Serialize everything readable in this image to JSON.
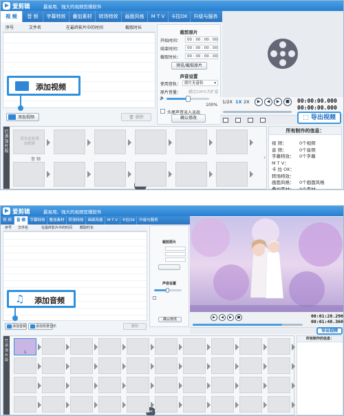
{
  "app": {
    "name": "爱剪辑",
    "slogan": "最易用、强大的视频剪辑软件"
  },
  "tabs": [
    {
      "label": "视 频",
      "active": true
    },
    {
      "label": "音 频"
    },
    {
      "label": "字幕特效"
    },
    {
      "label": "叠加素材"
    },
    {
      "label": "转场特效"
    },
    {
      "label": "画面风格"
    },
    {
      "label": "M T V"
    },
    {
      "label": "卡拉OK"
    },
    {
      "label": "升级与服务"
    }
  ],
  "columns": {
    "index": "序号",
    "name": "文件名",
    "source_time": "在最终影片中的时间",
    "cut_duration": "截取时长"
  },
  "clip_panel": {
    "title": "裁剪原片",
    "start_label": "开始时间：",
    "start_value": "00 : 00 : 00 . 000",
    "end_label": "结束时间：",
    "end_value": "00 : 00 : 00 . 000",
    "duration_label": "截取时长：",
    "duration_value": "00 : 00 : 00 . 000",
    "preview_btn": "预览/截取原片"
  },
  "audio_panel": {
    "title": "声音设置",
    "track_label": "使用音轨：",
    "track_value": "原片无音轨",
    "volume_label": "原片音量：",
    "volume_hint": "超过100%为扩音",
    "volume_value": "100%",
    "volume_level": 0.5,
    "fade_label": "头尾声音淡入淡出",
    "confirm_btn": "确认修改"
  },
  "player": {
    "speeds": [
      "1/2X",
      "1X",
      "2X"
    ],
    "active_speed": "1X",
    "time_current": "00:00:00.000",
    "time_total": "00:00:00.000",
    "export_btn": "导出视频"
  },
  "actions": {
    "add_video_btn": "添加视频",
    "delete_btn": "删除",
    "callout_video": "添加视频"
  },
  "info": {
    "title": "所有制作的信息：",
    "rows": [
      {
        "k": "视    频：",
        "v": "0个视频"
      },
      {
        "k": "音    频：",
        "v": "0个音频"
      },
      {
        "k": "字幕特效：",
        "v": "0个字幕"
      },
      {
        "k": "M  T  V：",
        "v": ""
      },
      {
        "k": "卡  拉  OK：",
        "v": ""
      },
      {
        "k": "转场特效：",
        "v": ""
      },
      {
        "k": "画面风格：",
        "v": "0个画面风格"
      },
      {
        "k": "叠加素材：",
        "v": "0个素材"
      }
    ]
  },
  "timeline": {
    "side_label": "已添加片段",
    "placeholder": "双击此处添加视频",
    "audio_label": "音 频"
  },
  "second": {
    "add_audio_callout": "添加音频",
    "add_audio_btn": "添加音频",
    "add_bgm_btn": "添加背景音乐",
    "time_current": "00:01:28.290",
    "time_total": "00:01:48.360",
    "export_btn": "导出视频",
    "clip_panel_title": "裁剪原片",
    "audio_panel_title": "声音设置",
    "confirm_btn": "确认修改",
    "clip_number": "1",
    "info_title": "所有制作的信息："
  }
}
